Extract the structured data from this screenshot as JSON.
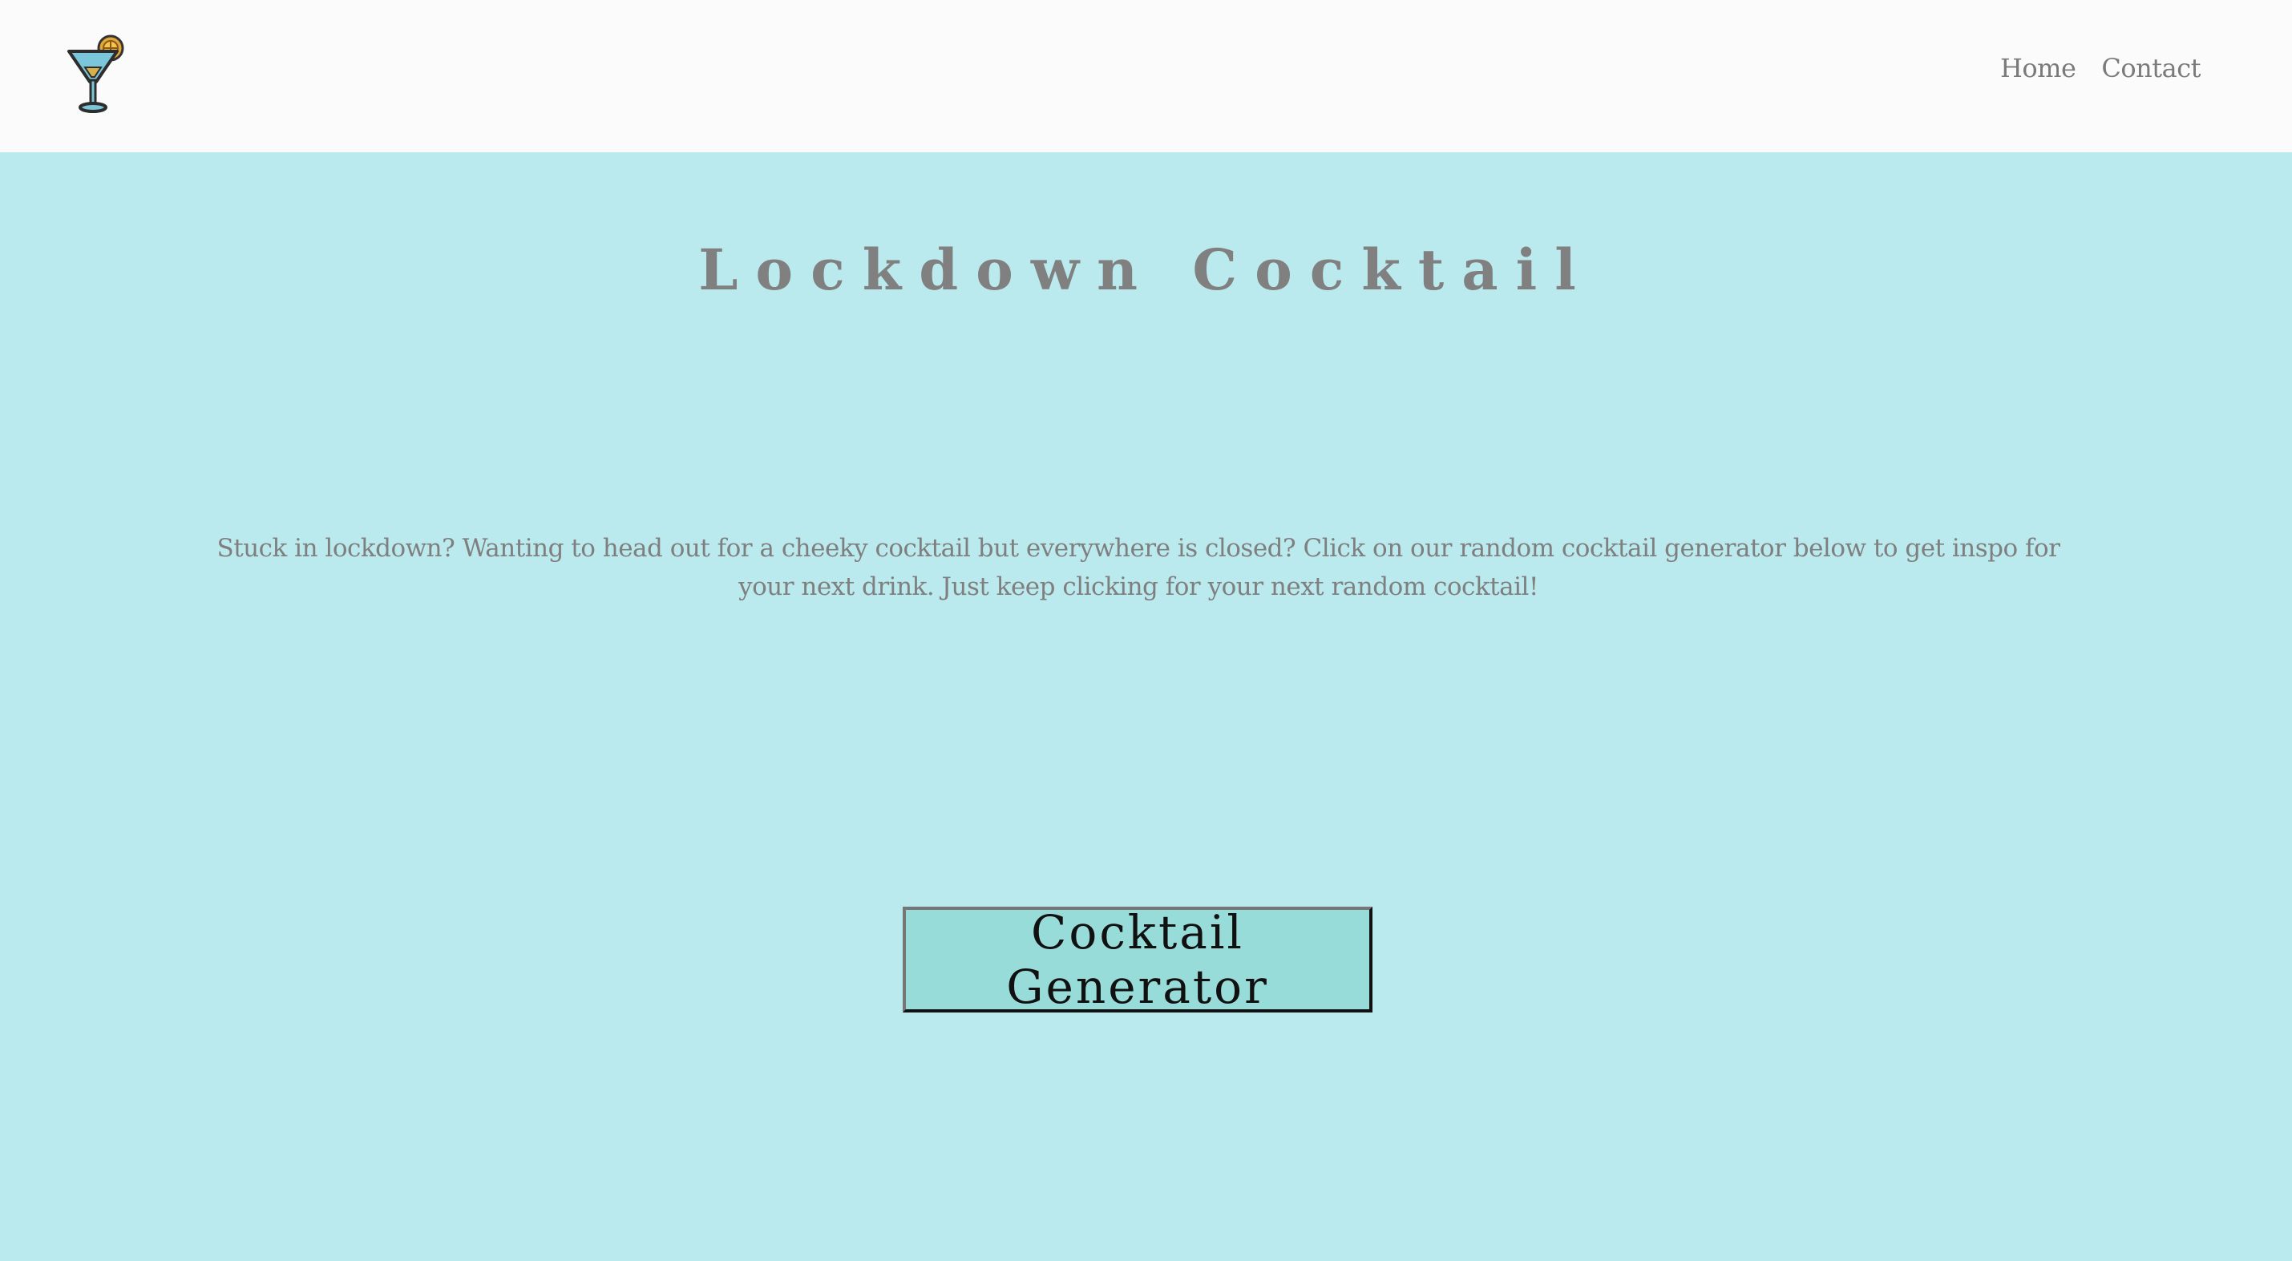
{
  "header": {
    "logo_icon": "cocktail-glass-icon",
    "nav": [
      {
        "label": "Home"
      },
      {
        "label": "Contact"
      }
    ]
  },
  "hero": {
    "title": "Lockdown Cocktail",
    "description": "Stuck in lockdown? Wanting to head out for a cheeky cocktail but everywhere is closed? Click on our random cocktail generator below to get inspo for your next drink. Just keep clicking for your next random cocktail!",
    "button_label": "Cocktail Generator"
  },
  "colors": {
    "header_bg": "#fbfbfb",
    "page_bg": "#bbeaee",
    "button_bg": "#97dcd8",
    "text_gray": "#7f7f7f"
  }
}
